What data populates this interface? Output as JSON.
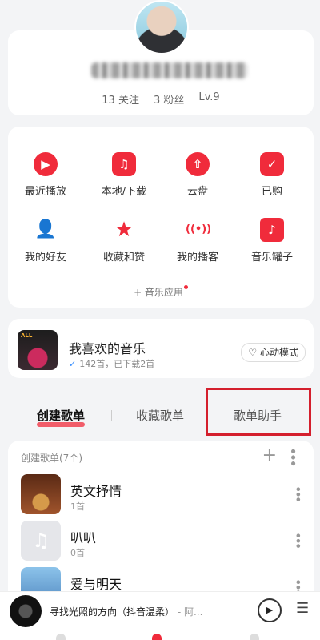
{
  "profile": {
    "following": "13 关注",
    "fans": "3 粉丝",
    "level": "Lv.9"
  },
  "features": [
    {
      "label": "最近播放",
      "icon": "play-icon",
      "glyph": "▶"
    },
    {
      "label": "本地/下载",
      "icon": "music-folder-icon",
      "glyph": "♫"
    },
    {
      "label": "云盘",
      "icon": "cloud-upload-icon",
      "glyph": "⇧"
    },
    {
      "label": "已购",
      "icon": "bag-check-icon",
      "glyph": "✓"
    },
    {
      "label": "我的好友",
      "icon": "person-icon",
      "glyph": "👤"
    },
    {
      "label": "收藏和赞",
      "icon": "star-icon",
      "glyph": "★"
    },
    {
      "label": "我的播客",
      "icon": "broadcast-icon",
      "glyph": "((•))"
    },
    {
      "label": "音乐罐子",
      "icon": "music-jar-icon",
      "glyph": "♪"
    }
  ],
  "music_app_label": "+ 音乐应用",
  "liked": {
    "title": "我喜欢的音乐",
    "subtitle": "142首，已下载2首",
    "heart_mode": "心动模式"
  },
  "tabs": {
    "created": "创建歌单",
    "collected": "收藏歌单",
    "assistant": "歌单助手"
  },
  "playlists": {
    "header": "创建歌单(7个)",
    "items": [
      {
        "name": "英文抒情",
        "count": "1首"
      },
      {
        "name": "叭叭",
        "count": "0首"
      },
      {
        "name": "爱与明天",
        "count": ""
      }
    ]
  },
  "player": {
    "song": "寻找光照的方向（抖音温柔）",
    "artist": " - 阿..."
  },
  "colors": {
    "accent": "#f02b3b",
    "highlight": "#d41f2d"
  }
}
